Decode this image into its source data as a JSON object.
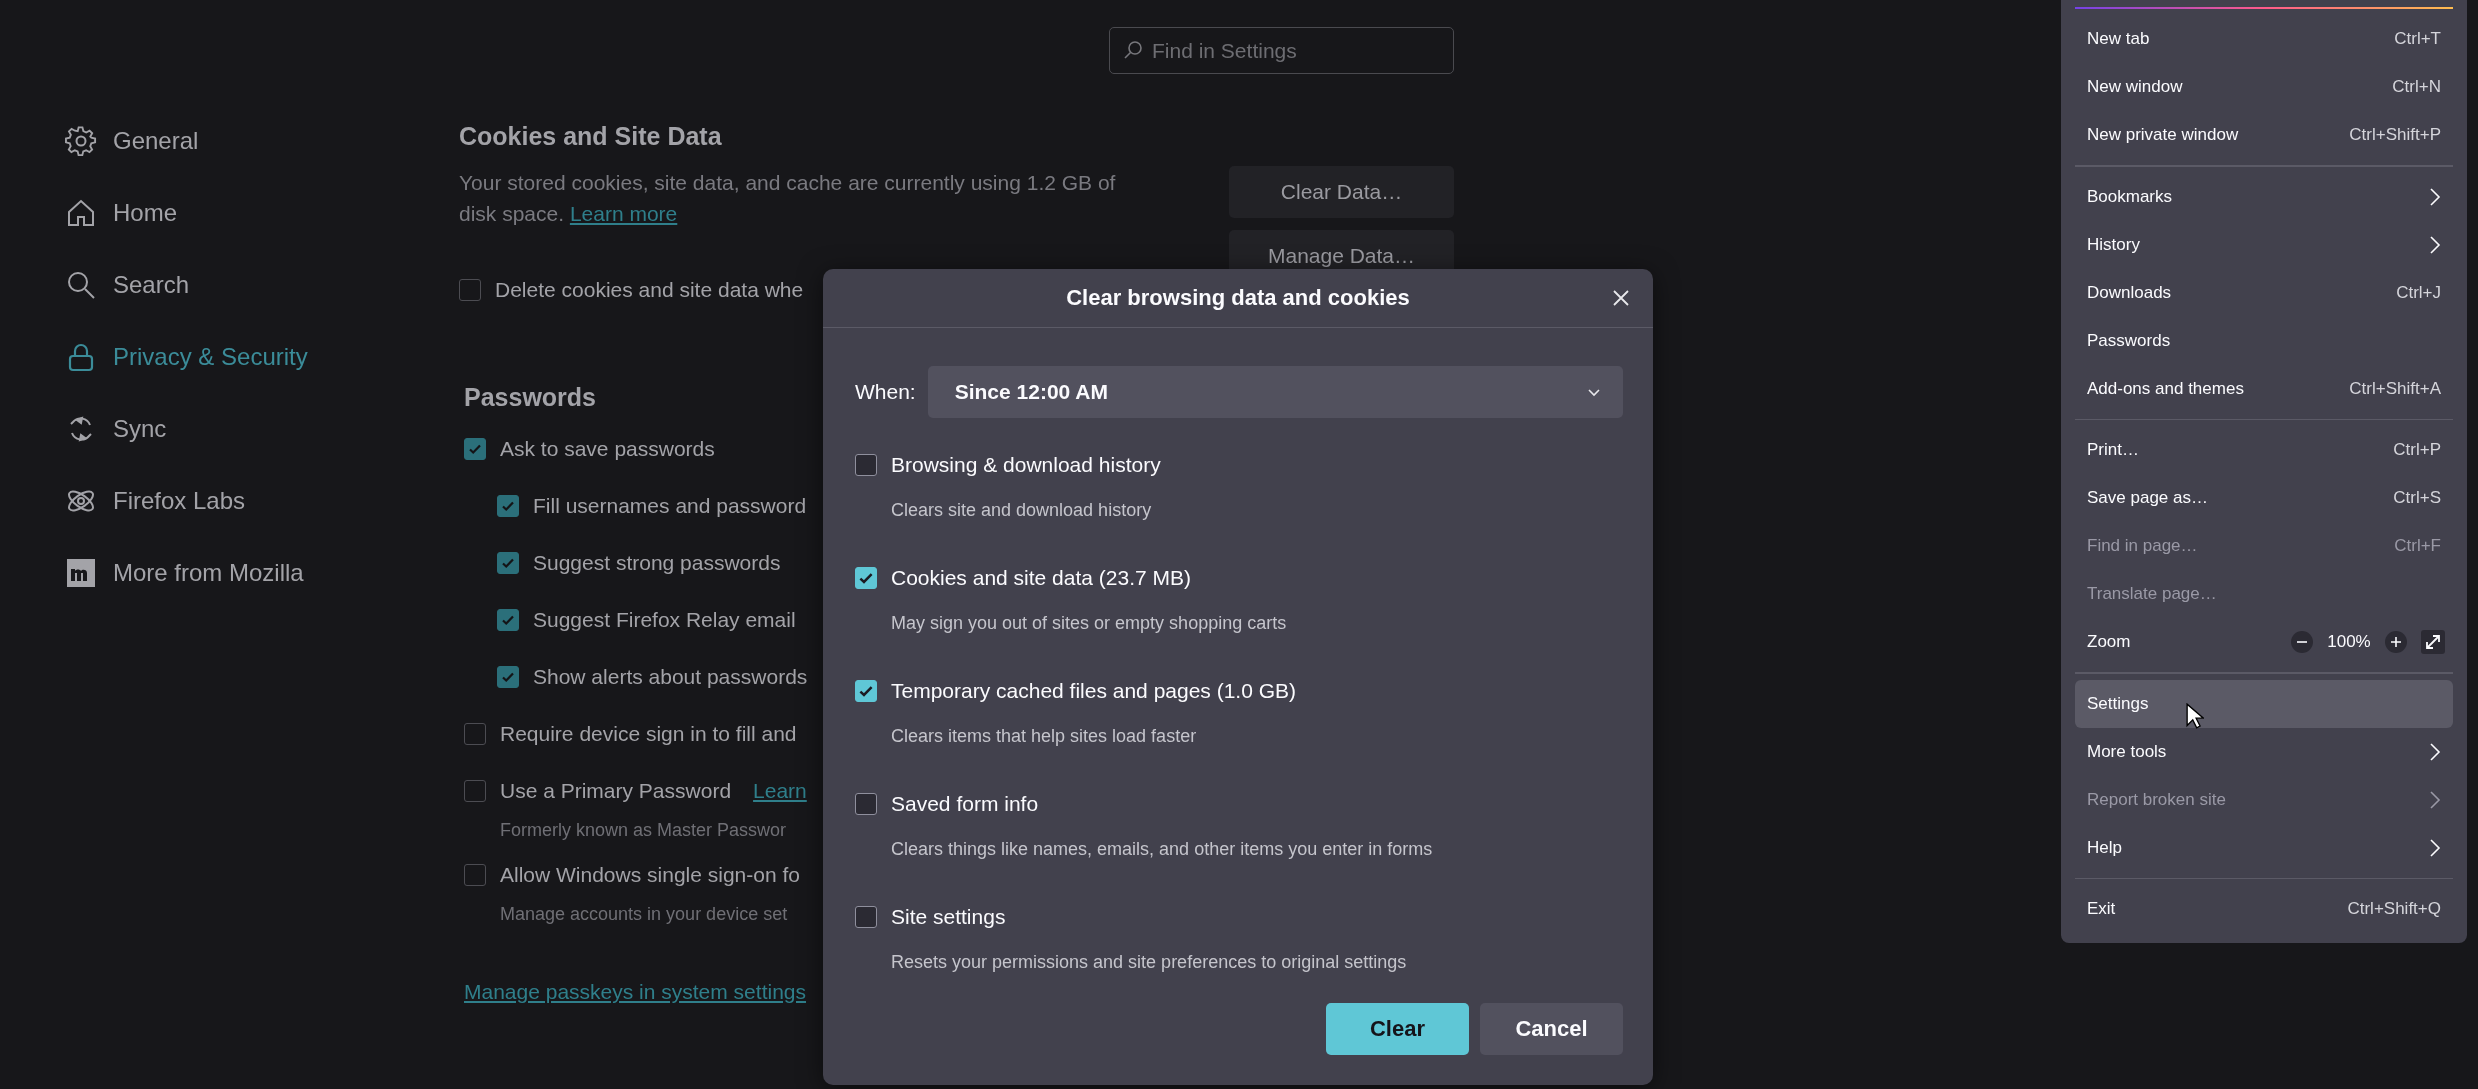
{
  "search": {
    "placeholder": "Find in Settings"
  },
  "sidebar": {
    "items": [
      {
        "label": "General",
        "selected": false
      },
      {
        "label": "Home",
        "selected": false
      },
      {
        "label": "Search",
        "selected": false
      },
      {
        "label": "Privacy & Security",
        "selected": true
      },
      {
        "label": "Sync",
        "selected": false
      },
      {
        "label": "Firefox Labs",
        "selected": false
      },
      {
        "label": "More from Mozilla",
        "selected": false
      }
    ]
  },
  "cookies": {
    "title": "Cookies and Site Data",
    "description": "Your stored cookies, site data, and cache are currently using 1.2 GB of disk space.",
    "link": "Learn more",
    "buttons": [
      "Clear Data…",
      "Manage Data…"
    ],
    "option": {
      "label": "Delete cookies and site data whe",
      "checked": false
    }
  },
  "passwords": {
    "title": "Passwords",
    "options": [
      {
        "label": "Ask to save passwords",
        "checked": true,
        "children": [
          {
            "label": "Fill usernames and password",
            "checked": true
          },
          {
            "label": "Suggest strong passwords",
            "checked": true
          },
          {
            "label": "Suggest Firefox Relay email",
            "checked": true
          },
          {
            "label": "Show alerts about passwords",
            "checked": true
          }
        ]
      },
      {
        "label": "Require device sign in to fill and",
        "checked": false
      },
      {
        "label": "Use a Primary Password",
        "checked": false,
        "link": "Learn",
        "note": "Formerly known as Master Passwor"
      },
      {
        "label": "Allow Windows single sign-on fo",
        "checked": false,
        "note": "Manage accounts in your device set"
      }
    ],
    "link": "Manage passkeys in system settings"
  },
  "dialog": {
    "title": "Clear browsing data and cookies",
    "when_label": "When:",
    "when_value": "Since 12:00 AM",
    "options": [
      {
        "label": "Browsing & download history",
        "description": "Clears site and download history",
        "checked": false
      },
      {
        "label": "Cookies and site data (23.7 MB)",
        "description": "May sign you out of sites or empty shopping carts",
        "checked": true
      },
      {
        "label": "Temporary cached files and pages (1.0 GB)",
        "description": "Clears items that help sites load faster",
        "checked": true
      },
      {
        "label": "Saved form info",
        "description": "Clears things like names, emails, and other items you enter in forms",
        "checked": false
      },
      {
        "label": "Site settings",
        "description": "Resets your permissions and site preferences to original settings",
        "checked": false
      }
    ],
    "buttons": [
      "Clear",
      "Cancel"
    ]
  },
  "app_menu": {
    "sections": [
      {
        "items": [
          {
            "label": "New tab",
            "kind": "shortcut",
            "shortcut": "Ctrl+T",
            "disabled": false,
            "selected": false
          },
          {
            "label": "New window",
            "kind": "shortcut",
            "shortcut": "Ctrl+N",
            "disabled": false,
            "selected": false
          },
          {
            "label": "New private window",
            "kind": "shortcut",
            "shortcut": "Ctrl+Shift+P",
            "disabled": false,
            "selected": false
          }
        ]
      },
      {
        "items": [
          {
            "label": "Bookmarks",
            "kind": "submenu",
            "disabled": false,
            "selected": false
          },
          {
            "label": "History",
            "kind": "submenu",
            "disabled": false,
            "selected": false
          },
          {
            "label": "Downloads",
            "kind": "shortcut",
            "shortcut": "Ctrl+J",
            "disabled": false,
            "selected": false
          },
          {
            "label": "Passwords",
            "kind": "plain",
            "disabled": false,
            "selected": false
          },
          {
            "label": "Add-ons and themes",
            "kind": "shortcut",
            "shortcut": "Ctrl+Shift+A",
            "disabled": false,
            "selected": false
          }
        ]
      },
      {
        "items": [
          {
            "label": "Print…",
            "kind": "shortcut",
            "shortcut": "Ctrl+P",
            "disabled": false,
            "selected": false
          },
          {
            "label": "Save page as…",
            "kind": "shortcut",
            "shortcut": "Ctrl+S",
            "disabled": false,
            "selected": false
          },
          {
            "label": "Find in page…",
            "kind": "shortcut",
            "shortcut": "Ctrl+F",
            "disabled": true,
            "selected": false
          },
          {
            "label": "Translate page…",
            "kind": "plain",
            "disabled": true,
            "selected": false
          },
          {
            "label": "Zoom",
            "kind": "zoom",
            "value": "100%",
            "disabled": false,
            "selected": false
          }
        ]
      },
      {
        "items": [
          {
            "label": "Settings",
            "kind": "plain",
            "disabled": false,
            "selected": true
          },
          {
            "label": "More tools",
            "kind": "submenu",
            "disabled": false,
            "selected": false
          },
          {
            "label": "Report broken site",
            "kind": "submenu",
            "disabled": true,
            "selected": false
          },
          {
            "label": "Help",
            "kind": "submenu",
            "disabled": false,
            "selected": false
          }
        ]
      },
      {
        "items": [
          {
            "label": "Exit",
            "kind": "shortcut",
            "shortcut": "Ctrl+Shift+Q",
            "disabled": false,
            "selected": false
          }
        ]
      }
    ]
  }
}
